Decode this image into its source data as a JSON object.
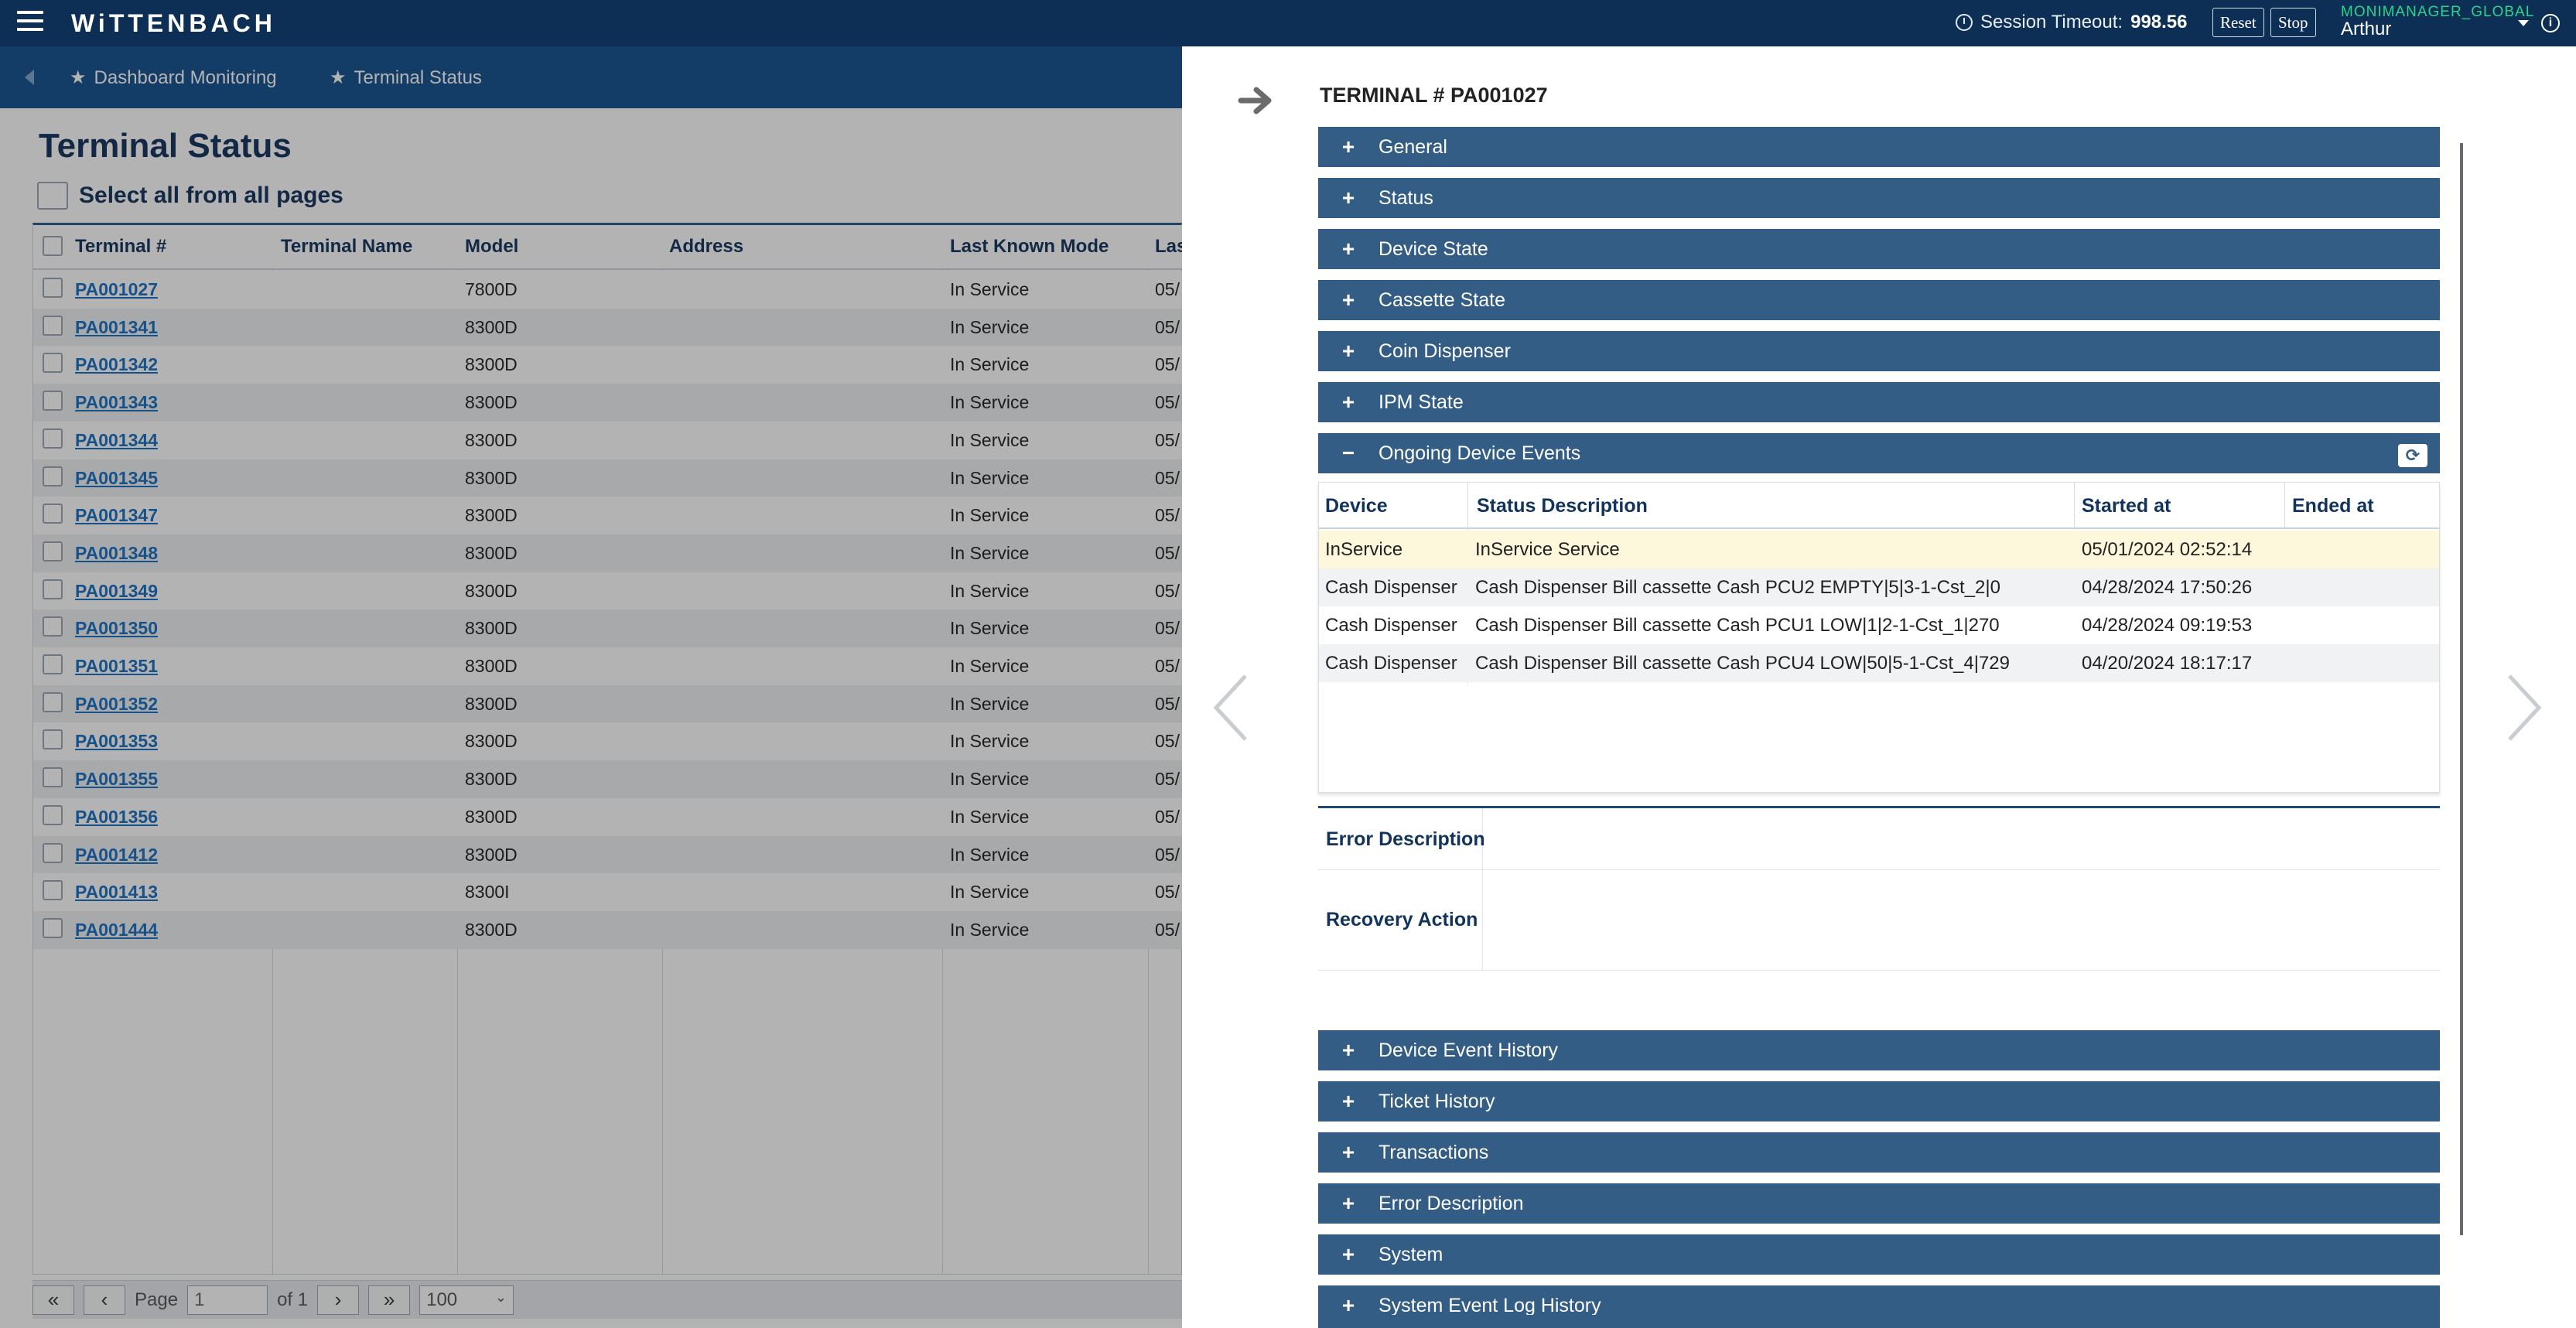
{
  "topbar": {
    "brand": "WiTTENBACH",
    "session_label": "Session Timeout:",
    "session_value": "998.56",
    "reset_label": "Reset",
    "stop_label": "Stop",
    "org": "MONIMANAGER_GLOBAL",
    "user": "Arthur"
  },
  "breadcrumb": {
    "items": [
      {
        "label": "Dashboard Monitoring"
      },
      {
        "label": "Terminal Status"
      }
    ]
  },
  "main": {
    "title": "Terminal Status",
    "select_all_label": "Select all from all pages",
    "columns": [
      "Terminal #",
      "Terminal Name",
      "Model",
      "Address",
      "Last Known Mode",
      "Las"
    ],
    "rows": [
      {
        "terminal": "PA001027",
        "name": "",
        "model": "7800D",
        "address": "",
        "mode": "In Service",
        "last": "05/"
      },
      {
        "terminal": "PA001341",
        "name": "",
        "model": "8300D",
        "address": "",
        "mode": "In Service",
        "last": "05/"
      },
      {
        "terminal": "PA001342",
        "name": "",
        "model": "8300D",
        "address": "",
        "mode": "In Service",
        "last": "05/"
      },
      {
        "terminal": "PA001343",
        "name": "",
        "model": "8300D",
        "address": "",
        "mode": "In Service",
        "last": "05/"
      },
      {
        "terminal": "PA001344",
        "name": "",
        "model": "8300D",
        "address": "",
        "mode": "In Service",
        "last": "05/"
      },
      {
        "terminal": "PA001345",
        "name": "",
        "model": "8300D",
        "address": "",
        "mode": "In Service",
        "last": "05/"
      },
      {
        "terminal": "PA001347",
        "name": "",
        "model": "8300D",
        "address": "",
        "mode": "In Service",
        "last": "05/"
      },
      {
        "terminal": "PA001348",
        "name": "",
        "model": "8300D",
        "address": "",
        "mode": "In Service",
        "last": "05/"
      },
      {
        "terminal": "PA001349",
        "name": "",
        "model": "8300D",
        "address": "",
        "mode": "In Service",
        "last": "05/"
      },
      {
        "terminal": "PA001350",
        "name": "",
        "model": "8300D",
        "address": "",
        "mode": "In Service",
        "last": "05/"
      },
      {
        "terminal": "PA001351",
        "name": "",
        "model": "8300D",
        "address": "",
        "mode": "In Service",
        "last": "05/"
      },
      {
        "terminal": "PA001352",
        "name": "",
        "model": "8300D",
        "address": "",
        "mode": "In Service",
        "last": "05/"
      },
      {
        "terminal": "PA001353",
        "name": "",
        "model": "8300D",
        "address": "",
        "mode": "In Service",
        "last": "05/"
      },
      {
        "terminal": "PA001355",
        "name": "",
        "model": "8300D",
        "address": "",
        "mode": "In Service",
        "last": "05/"
      },
      {
        "terminal": "PA001356",
        "name": "",
        "model": "8300D",
        "address": "",
        "mode": "In Service",
        "last": "05/"
      },
      {
        "terminal": "PA001412",
        "name": "",
        "model": "8300D",
        "address": "",
        "mode": "In Service",
        "last": "05/"
      },
      {
        "terminal": "PA001413",
        "name": "",
        "model": "8300I",
        "address": "",
        "mode": "In Service",
        "last": "05/"
      },
      {
        "terminal": "PA001444",
        "name": "",
        "model": "8300D",
        "address": "",
        "mode": "In Service",
        "last": "05/"
      }
    ],
    "pager": {
      "first": "«",
      "prev": "‹",
      "page_label": "Page",
      "page_value": "1",
      "of_label": "of 1",
      "next": "›",
      "last": "»",
      "page_size": "100"
    }
  },
  "panel": {
    "title": "TERMINAL # PA001027",
    "sections_top": [
      {
        "label": "General",
        "sign": "+"
      },
      {
        "label": "Status",
        "sign": "+"
      },
      {
        "label": "Device State",
        "sign": "+"
      },
      {
        "label": "Cassette State",
        "sign": "+"
      },
      {
        "label": "Coin Dispenser",
        "sign": "+"
      },
      {
        "label": "IPM State",
        "sign": "+"
      },
      {
        "label": "Ongoing Device Events",
        "sign": "−"
      }
    ],
    "events": {
      "columns": [
        "Device",
        "Status Description",
        "Started at",
        "Ended at"
      ],
      "rows": [
        {
          "device": "InService",
          "desc": "InService Service",
          "started": "05/01/2024 02:52:14",
          "ended": ""
        },
        {
          "device": "Cash Dispenser",
          "desc": "Cash Dispenser Bill cassette Cash PCU2 EMPTY|5|3-1-Cst_2|0",
          "started": "04/28/2024 17:50:26",
          "ended": ""
        },
        {
          "device": "Cash Dispenser",
          "desc": "Cash Dispenser Bill cassette Cash PCU1 LOW|1|2-1-Cst_1|270",
          "started": "04/28/2024 09:19:53",
          "ended": ""
        },
        {
          "device": "Cash Dispenser",
          "desc": "Cash Dispenser Bill cassette Cash PCU4 LOW|50|5-1-Cst_4|729",
          "started": "04/20/2024 18:17:17",
          "ended": ""
        }
      ]
    },
    "error_description_label": "Error Description",
    "recovery_action_label": "Recovery Action",
    "sections_bottom": [
      {
        "label": "Device Event History",
        "sign": "+"
      },
      {
        "label": "Ticket History",
        "sign": "+"
      },
      {
        "label": "Transactions",
        "sign": "+"
      },
      {
        "label": "Error Description",
        "sign": "+"
      },
      {
        "label": "System",
        "sign": "+"
      },
      {
        "label": "System Event Log History",
        "sign": "+"
      }
    ]
  },
  "colors": {
    "topbar": "#0d2f55",
    "breadcrumb": "#145290",
    "accordion": "#335d85",
    "title_text": "#12335c",
    "link": "#1a6fc3",
    "highlight_row": "#fdf8dc",
    "org_text": "#2bd48a"
  }
}
